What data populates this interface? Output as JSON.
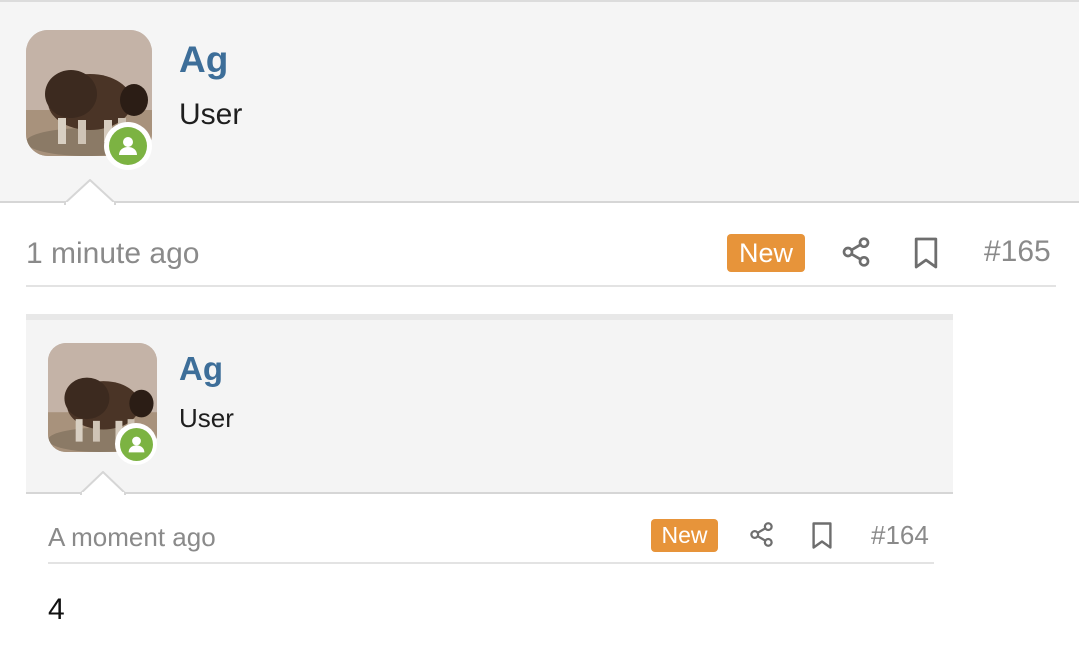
{
  "post1": {
    "username": "Ag",
    "role": "User",
    "time": "1 minute ago",
    "badge": "New",
    "number": "#165"
  },
  "post2": {
    "username": "Ag",
    "role": "User",
    "time": "A moment ago",
    "badge": "New",
    "number": "#164",
    "body": "4"
  },
  "icons": [
    "avatar",
    "online-status-icon",
    "share-icon",
    "bookmark-icon"
  ],
  "colors": {
    "username": "#3d6e99",
    "badge": "#e7943a",
    "online": "#7cb342",
    "header_bg": "#f5f5f5"
  }
}
